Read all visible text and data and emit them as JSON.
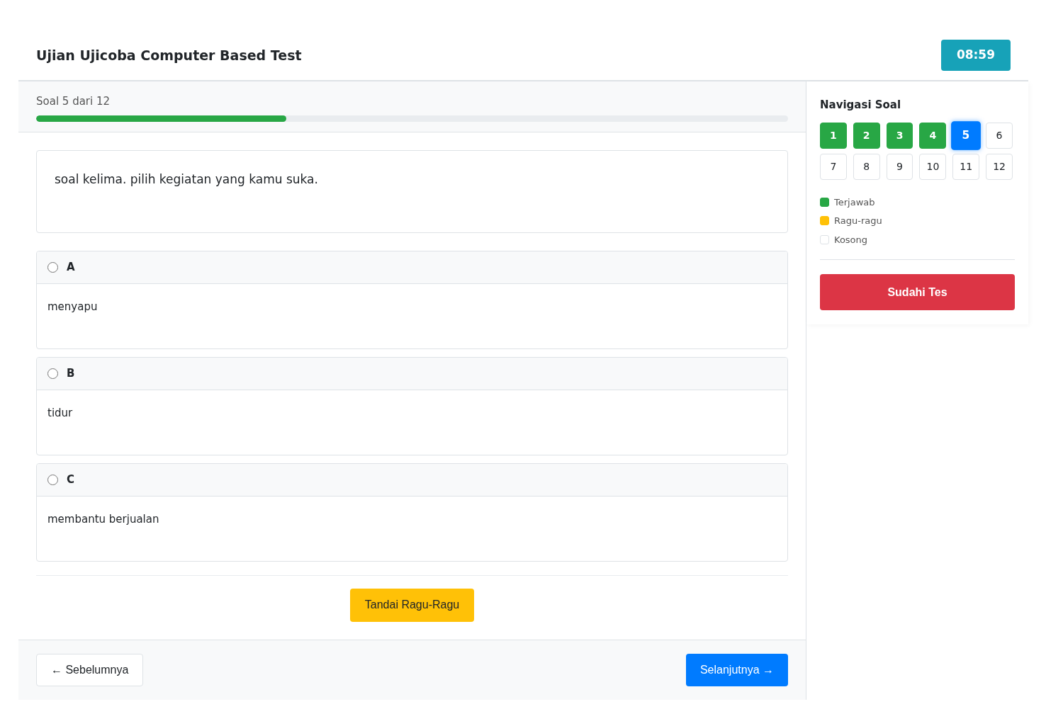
{
  "header": {
    "title": "Ujian Ujicoba Computer Based Test",
    "timer": "08:59"
  },
  "progress": {
    "label": "Soal 5 dari 12",
    "level": 0.333
  },
  "question": {
    "text": "soal kelima. pilih kegiatan yang kamu suka."
  },
  "options": [
    {
      "letter": "A",
      "text": "menyapu",
      "selected": false
    },
    {
      "letter": "B",
      "text": "tidur",
      "selected": false
    },
    {
      "letter": "C",
      "text": "membantu berjualan",
      "selected": false
    }
  ],
  "doubt_button": "Tandai Ragu-Ragu",
  "footer": {
    "prev": "← Sebelumnya",
    "next": "Selanjutnya →"
  },
  "navigation": {
    "title": "Navigasi Soal",
    "items": [
      {
        "label": "1",
        "answered": true,
        "selected": false
      },
      {
        "label": "2",
        "answered": true,
        "selected": false
      },
      {
        "label": "3",
        "answered": true,
        "selected": false
      },
      {
        "label": "4",
        "answered": true,
        "selected": false
      },
      {
        "label": "5",
        "answered": false,
        "selected": true
      },
      {
        "label": "6",
        "answered": false,
        "selected": false
      },
      {
        "label": "7",
        "answered": false,
        "selected": false
      },
      {
        "label": "8",
        "answered": false,
        "selected": false
      },
      {
        "label": "9",
        "answered": false,
        "selected": false
      },
      {
        "label": "10",
        "answered": false,
        "selected": false
      },
      {
        "label": "11",
        "answered": false,
        "selected": false
      },
      {
        "label": "12",
        "answered": false,
        "selected": false
      }
    ],
    "legend": [
      {
        "label": "Terjawab",
        "color": "#28a745"
      },
      {
        "label": "Ragu-ragu",
        "color": "#ffc107"
      },
      {
        "label": "Kosong",
        "color": "#ffffff"
      }
    ],
    "finish_button": "Sudahi Tes"
  }
}
